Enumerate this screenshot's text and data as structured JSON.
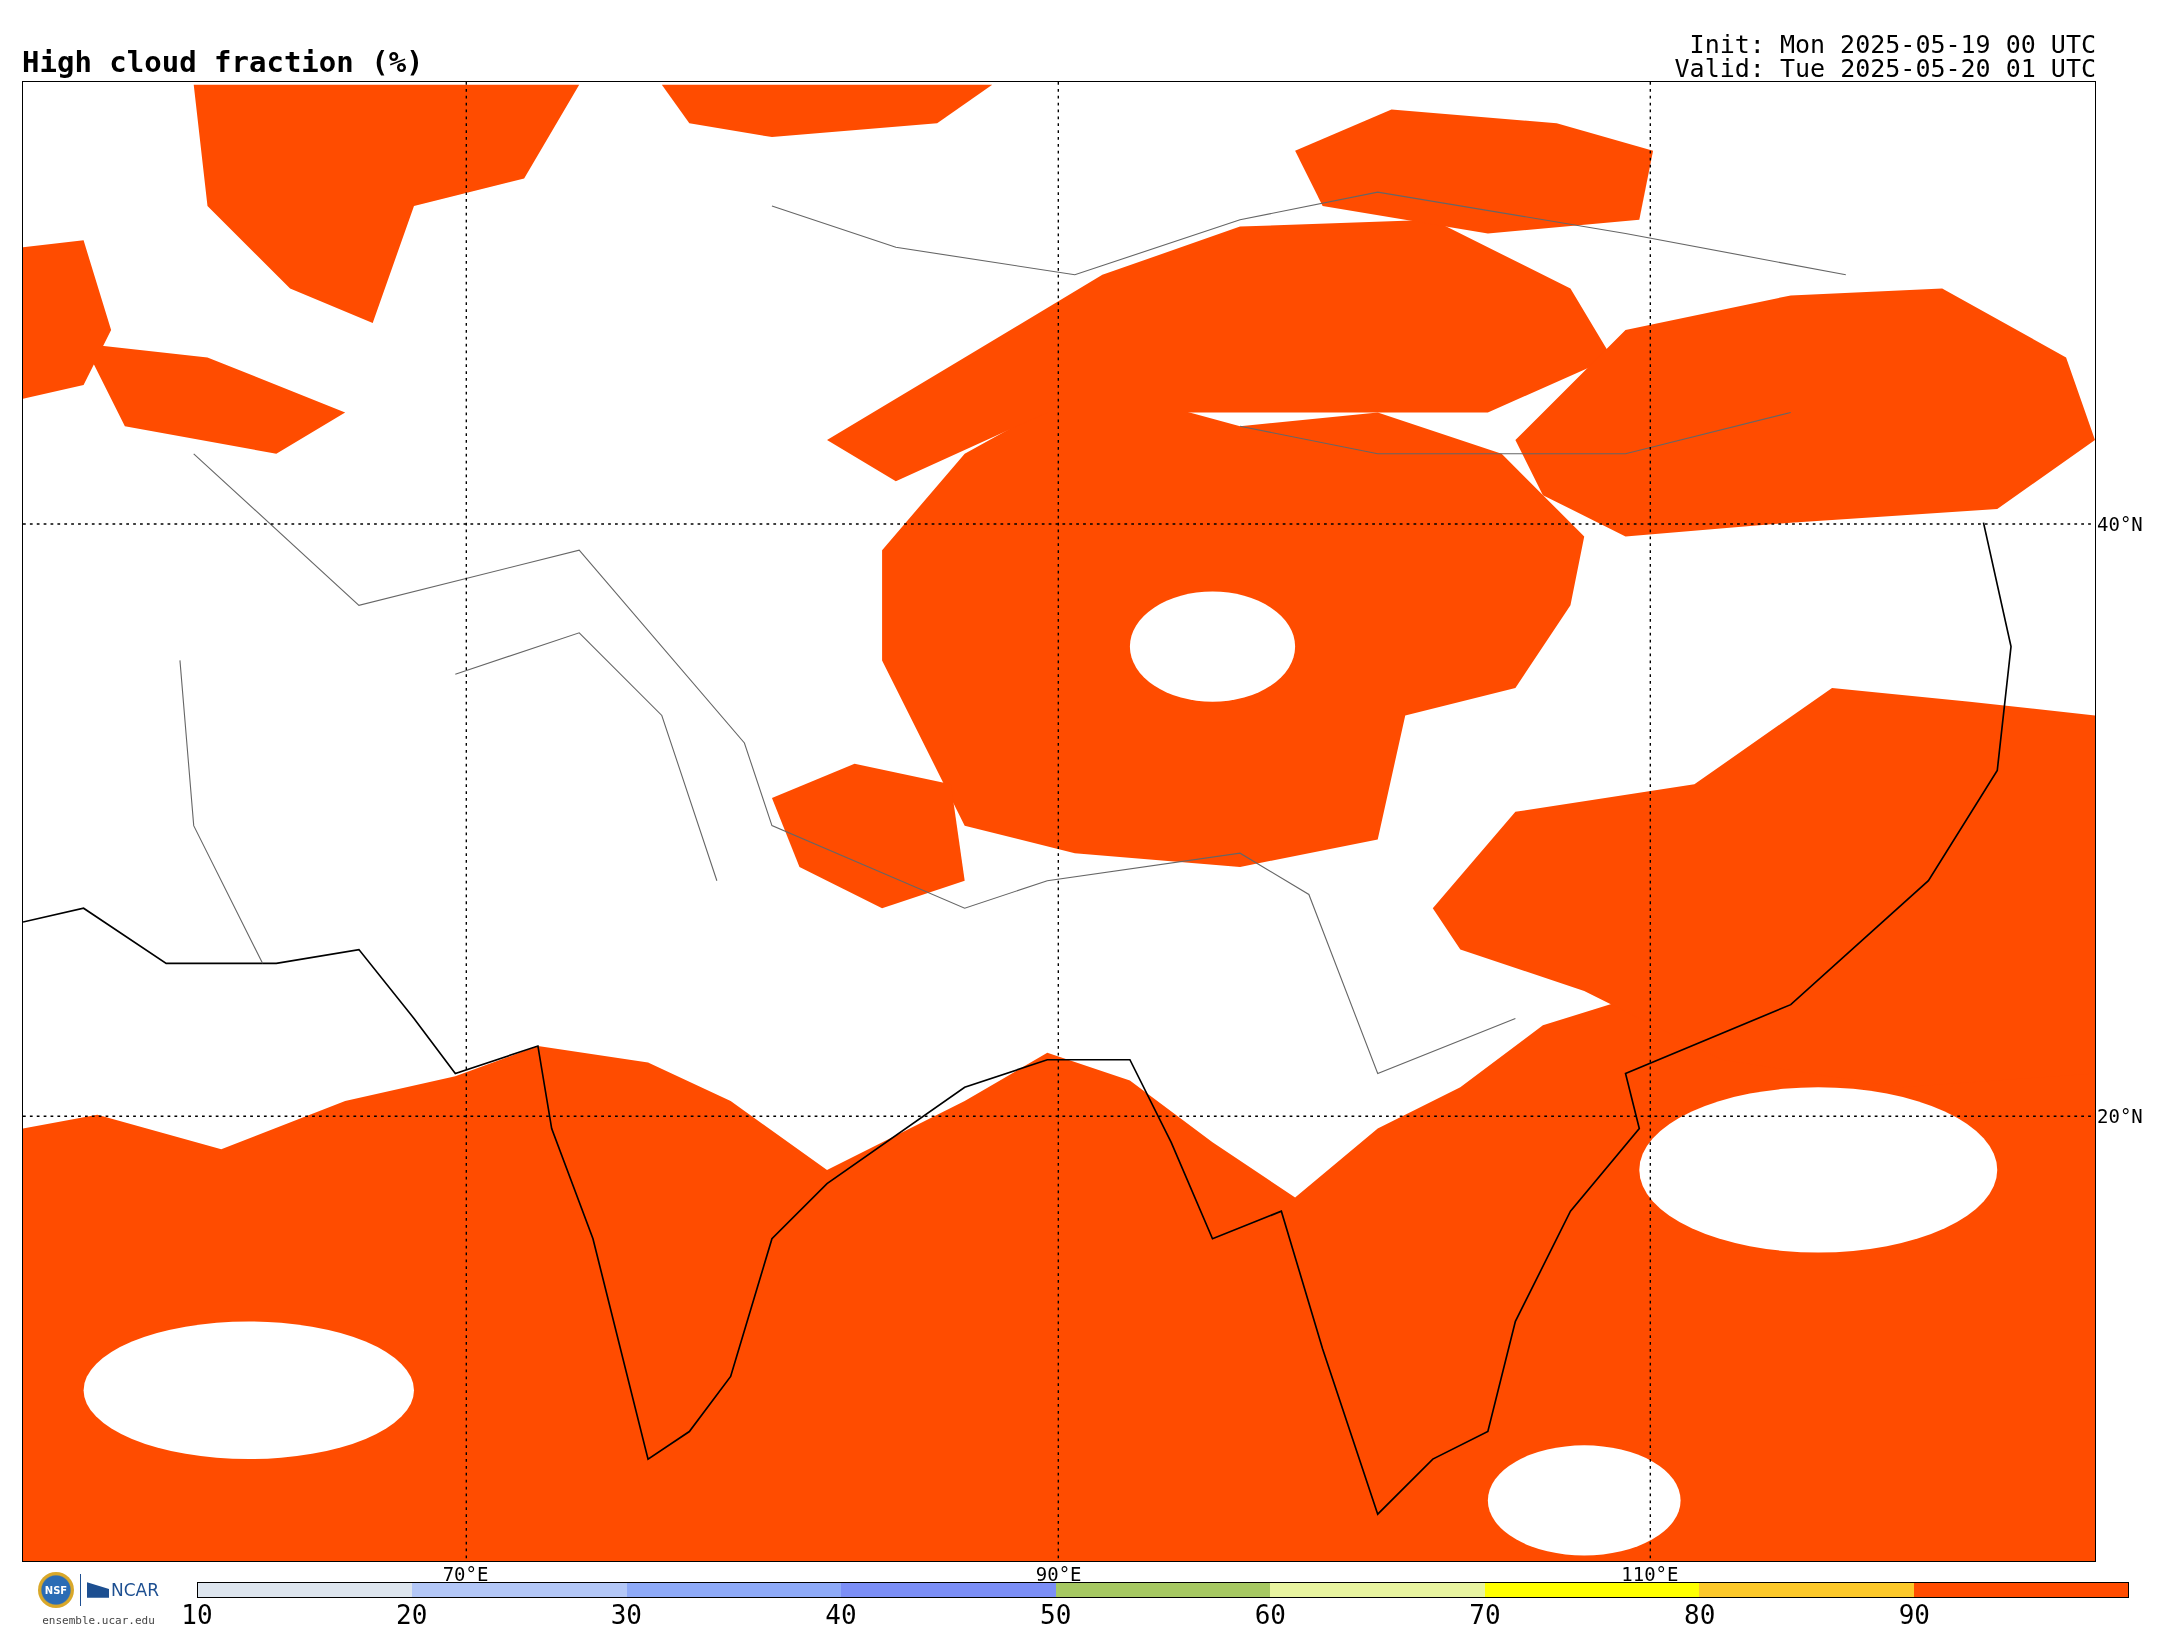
{
  "title": "High cloud fraction (%)",
  "init": "Init: Mon 2025-05-19 00 UTC",
  "valid": "Valid: Tue 2025-05-20 01 UTC",
  "lat_labels": [
    "40°N",
    "20°N"
  ],
  "lon_labels": [
    "70°E",
    "90°E",
    "110°E"
  ],
  "logo": {
    "seal": "NSF",
    "org": "NCAR",
    "site": "ensemble.ucar.edu"
  },
  "colorbar": {
    "ticks": [
      "10",
      "20",
      "30",
      "40",
      "50",
      "60",
      "70",
      "80",
      "90"
    ],
    "bins": [
      {
        "color": "#dde5ee"
      },
      {
        "color": "#b3c7f7"
      },
      {
        "color": "#8eaaf8"
      },
      {
        "color": "#7b8ef6"
      },
      {
        "color": "#a6c862"
      },
      {
        "color": "#e8f4a0"
      },
      {
        "color": "#ffff00"
      },
      {
        "color": "#fcc829"
      },
      {
        "color": "#ff4c00"
      }
    ]
  }
}
